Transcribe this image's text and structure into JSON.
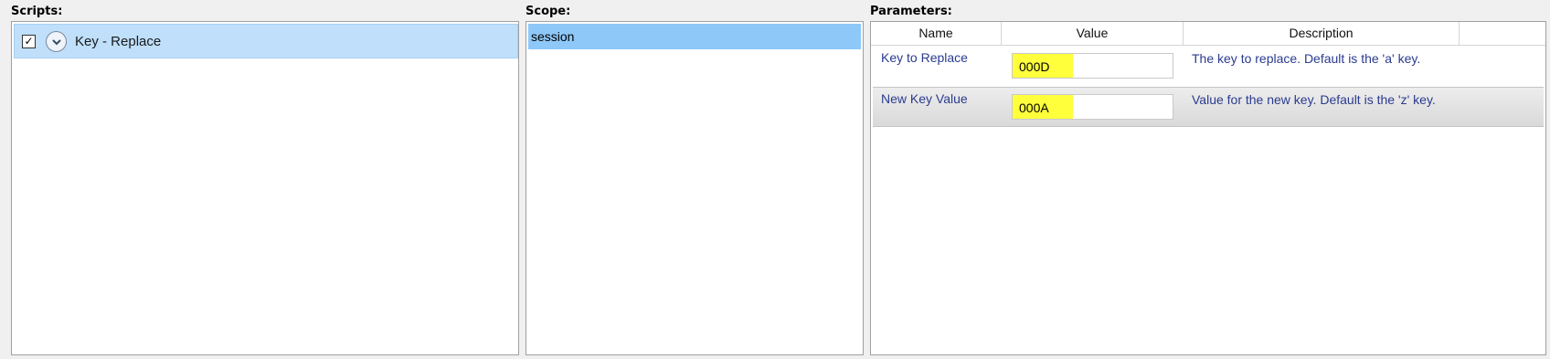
{
  "scripts": {
    "label": "Scripts:",
    "items": [
      {
        "name": "Key - Replace",
        "checked": true,
        "check_glyph": "✓"
      }
    ]
  },
  "scope": {
    "label": "Scope:",
    "items": [
      "session"
    ]
  },
  "parameters": {
    "label": "Parameters:",
    "columns": [
      "Name",
      "Value",
      "Description"
    ],
    "rows": [
      {
        "name": "Key to Replace",
        "value": "000D",
        "description": "The key to replace. Default is the 'a' key."
      },
      {
        "name": "New Key Value",
        "value": "000A",
        "description": "Value for the new key. Default is the 'z' key."
      }
    ]
  },
  "colors": {
    "selection": "#bfdffb",
    "scope_selection": "#8ec8f8",
    "highlight": "#ffff3c",
    "param_text": "#2a3b8f"
  },
  "icons": [
    "checkbox-checked-icon",
    "chevron-down-icon"
  ]
}
